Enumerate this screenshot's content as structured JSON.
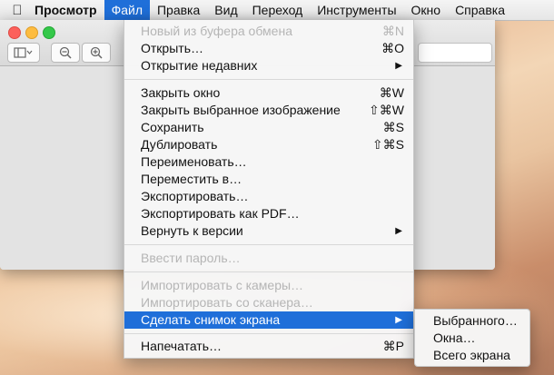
{
  "menubar": {
    "app_name": "Просмотр",
    "items": [
      "Файл",
      "Правка",
      "Вид",
      "Переход",
      "Инструменты",
      "Окно",
      "Справка"
    ]
  },
  "file_menu": {
    "items": [
      {
        "label": "Новый из буфера обмена",
        "shortcut": "⌘N",
        "disabled": true
      },
      {
        "label": "Открыть…",
        "shortcut": "⌘O"
      },
      {
        "label": "Открытие недавних",
        "submenu": true
      },
      {
        "label": "Закрыть окно",
        "shortcut": "⌘W"
      },
      {
        "label": "Закрыть выбранное изображение",
        "shortcut": "⇧⌘W"
      },
      {
        "label": "Сохранить",
        "shortcut": "⌘S"
      },
      {
        "label": "Дублировать",
        "shortcut": "⇧⌘S"
      },
      {
        "label": "Переименовать…"
      },
      {
        "label": "Переместить в…"
      },
      {
        "label": "Экспортировать…"
      },
      {
        "label": "Экспортировать как PDF…"
      },
      {
        "label": "Вернуть к версии",
        "submenu": true
      },
      {
        "label": "Ввести пароль…",
        "disabled": true
      },
      {
        "label": "Импортировать с камеры…",
        "disabled": true
      },
      {
        "label": "Импортировать со сканера…",
        "disabled": true
      },
      {
        "label": "Сделать снимок экрана",
        "submenu": true,
        "highlighted": true
      },
      {
        "label": "Напечатать…",
        "shortcut": "⌘P"
      }
    ]
  },
  "screenshot_submenu": {
    "items": [
      "Выбранного…",
      "Окна…",
      "Всего экрана"
    ]
  },
  "colors": {
    "highlight": "#1f6fd9",
    "disabled_text": "#b5b5b5"
  }
}
